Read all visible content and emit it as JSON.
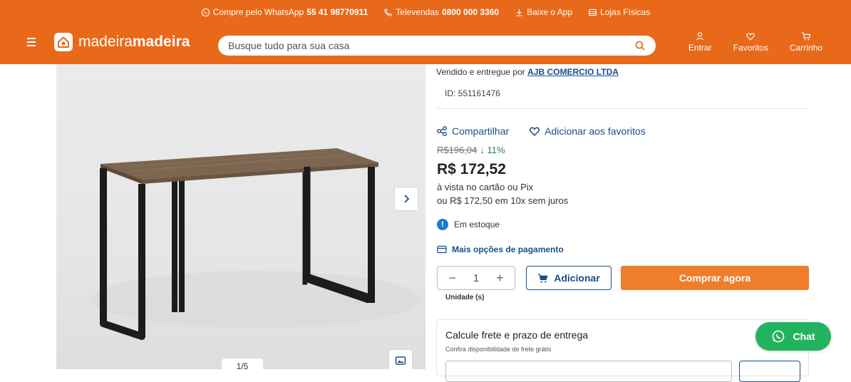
{
  "topbar": {
    "whatsapp_label": "Compre pelo WhatsApp",
    "whatsapp_number": "55 41 98770911",
    "televendas_label": "Televendas",
    "televendas_number": "0800 000 3360",
    "app_label": "Baixe o App",
    "stores_label": "Lojas Físicas"
  },
  "header": {
    "brand_light": "madeira",
    "brand_bold": "madeira",
    "search_placeholder": "Busque tudo para sua casa",
    "login_label": "Entrar",
    "favorites_label": "Favoritos",
    "cart_label": "Carrinho"
  },
  "gallery": {
    "counter": "1/5"
  },
  "product": {
    "sold_by_prefix": "Vendido e entregue por",
    "seller": "AJB COMERCIO LTDA",
    "id_text": "ID: 551161476",
    "share_label": "Compartilhar",
    "favorite_label": "Adicionar aos favoritos",
    "old_price": "R$196,04",
    "discount": "↓ 11%",
    "price": "R$ 172,52",
    "payment_condition": "à vista no cartão ou Pix",
    "installments": "ou R$ 172,50 em 10x sem juros",
    "stock_status": "Em estoque",
    "more_payment_label": "Mais opções de pagamento",
    "quantity": "1",
    "unit_label": "Unidade (s)",
    "add_label": "Adicionar",
    "buy_label": "Comprar agora"
  },
  "freight": {
    "title": "Calcule frete e prazo de entrega",
    "subtitle": "Confira disponibilidade de frete grátis"
  },
  "chat": {
    "label": "Chat"
  },
  "colors": {
    "header_orange": "#e8691a",
    "buy_orange": "#ef7d2a",
    "link_blue": "#1a4e8a",
    "chat_green": "#23b35f",
    "discount_green": "#2e7d5b"
  }
}
